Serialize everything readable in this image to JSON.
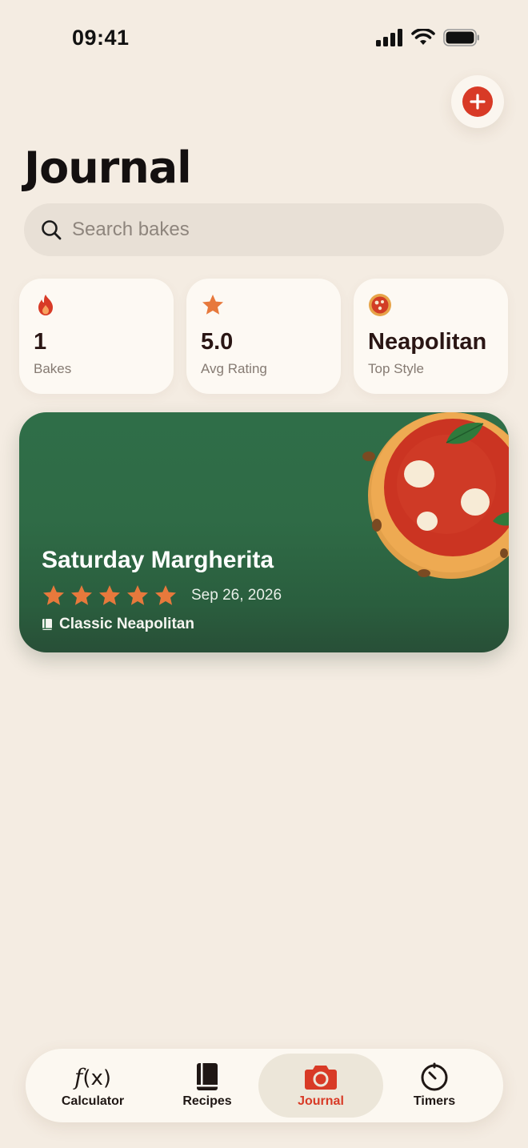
{
  "status_bar": {
    "time": "09:41"
  },
  "header": {
    "title": "Journal"
  },
  "search": {
    "placeholder": "Search bakes"
  },
  "stats": [
    {
      "value": "1",
      "label": "Bakes",
      "icon": "flame-icon"
    },
    {
      "value": "5.0",
      "label": "Avg Rating",
      "icon": "star-icon"
    },
    {
      "value": "Neapolitan",
      "label": "Top Style",
      "icon": "pizza-icon"
    }
  ],
  "bakes": [
    {
      "title": "Saturday Margherita",
      "rating": 5,
      "date": "Sep 26, 2026",
      "style": "Classic Neapolitan"
    }
  ],
  "tabs": [
    {
      "label": "Calculator",
      "icon": "function-icon",
      "active": false
    },
    {
      "label": "Recipes",
      "icon": "book-icon",
      "active": false
    },
    {
      "label": "Journal",
      "icon": "camera-icon",
      "active": true
    },
    {
      "label": "Timers",
      "icon": "timer-icon",
      "active": false
    }
  ],
  "colors": {
    "background": "#f4ece2",
    "accent": "#d83a26",
    "card_green": "#2f6e48",
    "star": "#e7793c"
  }
}
